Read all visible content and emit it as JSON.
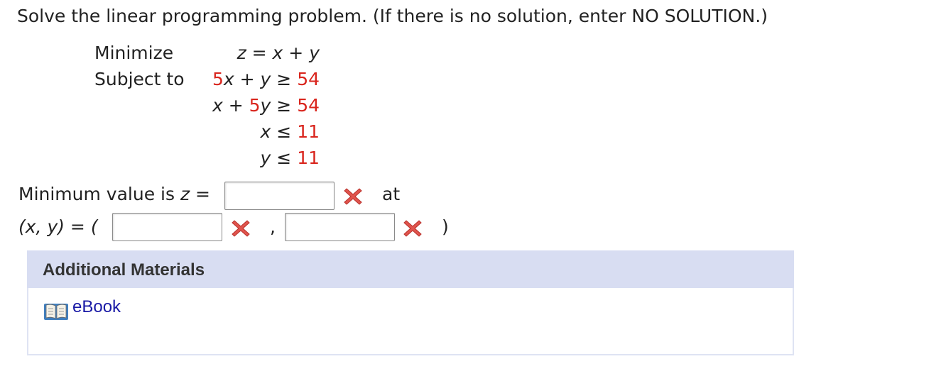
{
  "prompt": "Solve the linear programming problem. (If there is no solution, enter NO SOLUTION.)",
  "problem": {
    "minimize_label": "Minimize",
    "subject_to_label": "Subject to",
    "objective": "z = x + y",
    "constraints": [
      {
        "coef": "5",
        "text": "x + y ≥ ",
        "rhs": "54"
      },
      {
        "text": "x + ",
        "coef": "5",
        "var": "y",
        "sym": " ≥ ",
        "rhs": "54"
      },
      {
        "var": "x",
        "sym": " ≤ ",
        "rhs": "11"
      },
      {
        "var": "y",
        "sym": " ≤ ",
        "rhs": "11"
      }
    ]
  },
  "answer": {
    "min_label_prefix": "Minimum value is ",
    "min_label_var": "z",
    "min_label_eq": " =",
    "at_label": "at",
    "xy_label": "(x, y) = (",
    "comma": ",",
    "close_paren": ")",
    "z_value": "",
    "x_value": "",
    "y_value": ""
  },
  "additional": {
    "title": "Additional Materials",
    "ebook_label": "eBook"
  },
  "colors": {
    "accent_red": "#d9251d",
    "panel_header": "#d8ddf2",
    "link_blue": "#1a1aa6"
  },
  "icons": [
    "incorrect-x-icon",
    "book-icon"
  ]
}
